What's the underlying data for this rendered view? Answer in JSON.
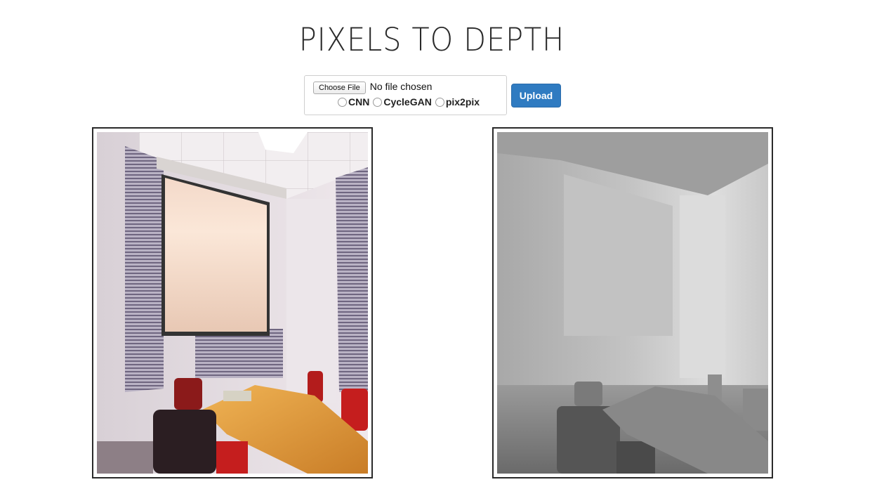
{
  "header": {
    "title": "PIXELS TO DEPTH"
  },
  "form": {
    "choose_file_label": "Choose File",
    "file_status": "No file chosen",
    "models": [
      {
        "label": "CNN"
      },
      {
        "label": "CycleGAN"
      },
      {
        "label": "pix2pix"
      }
    ],
    "upload_label": "Upload"
  }
}
